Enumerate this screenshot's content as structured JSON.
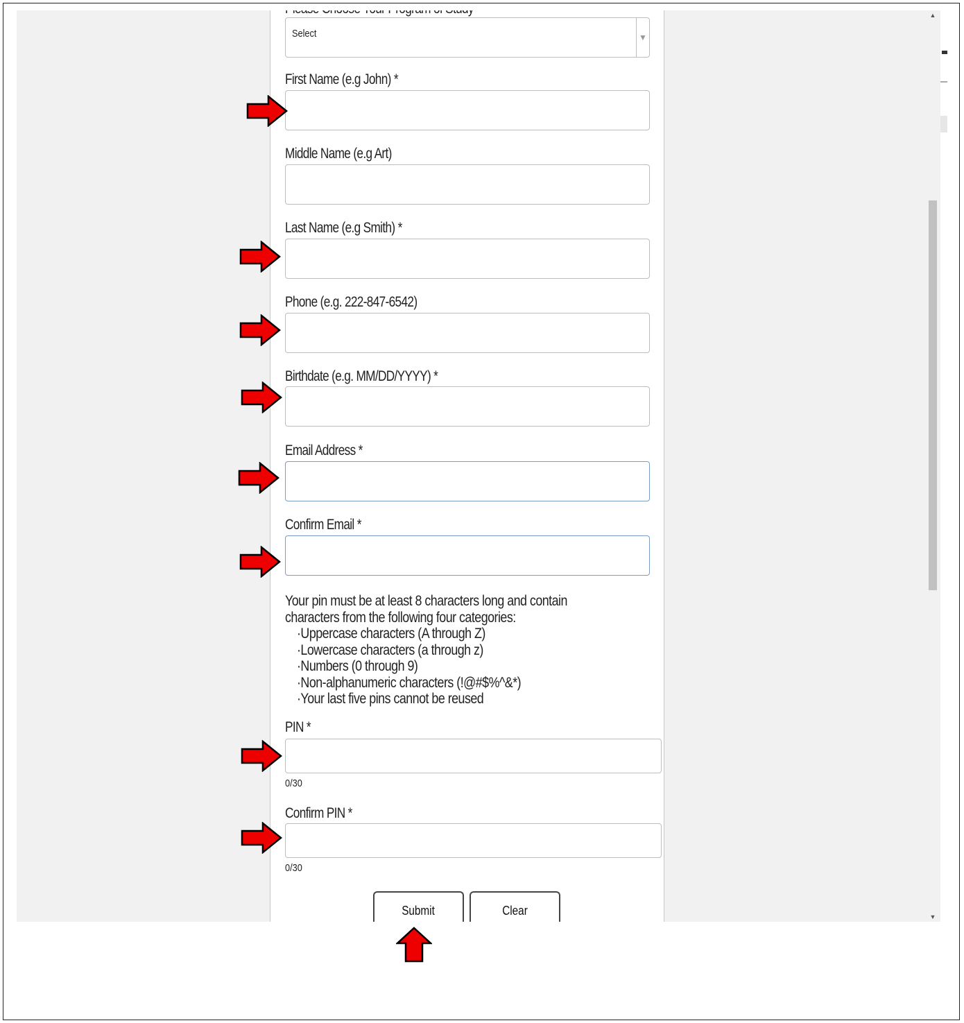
{
  "form": {
    "program_label": "Please Choose Your Program of Study",
    "program_select": "Select",
    "first_name_label": "First Name (e.g John) *",
    "middle_name_label": "Middle Name (e.g Art)",
    "last_name_label": "Last Name (e.g Smith) *",
    "phone_label": "Phone (e.g. 222-847-6542)",
    "birthdate_label": "Birthdate (e.g. MM/DD/YYYY) *",
    "email_label": "Email Address *",
    "confirm_email_label": "Confirm Email *",
    "pin_help": {
      "line1": "Your pin must be at least 8 characters long and contain",
      "line2": "characters from the following four categories:",
      "items": [
        "·Uppercase characters (A through Z)",
        "·Lowercase characters (a through z)",
        "·Numbers (0 through 9)",
        "·Non-alphanumeric characters (!@#$%^&*)",
        "·Your last five pins cannot be reused"
      ]
    },
    "pin_label": "PIN *",
    "pin_counter": "0/30",
    "confirm_pin_label": "Confirm PIN *",
    "confirm_pin_counter": "0/30",
    "submit_label": "Submit",
    "clear_label": "Clear"
  },
  "colors": {
    "arrow_fill": "#ee0000",
    "arrow_stroke": "#000000",
    "focus_border": "#7a9cc6"
  },
  "icons": {
    "annotation": "red-arrow-icon",
    "select": "chevron-down-icon",
    "scroll_up": "scroll-up-icon",
    "scroll_down": "scroll-down-icon"
  }
}
